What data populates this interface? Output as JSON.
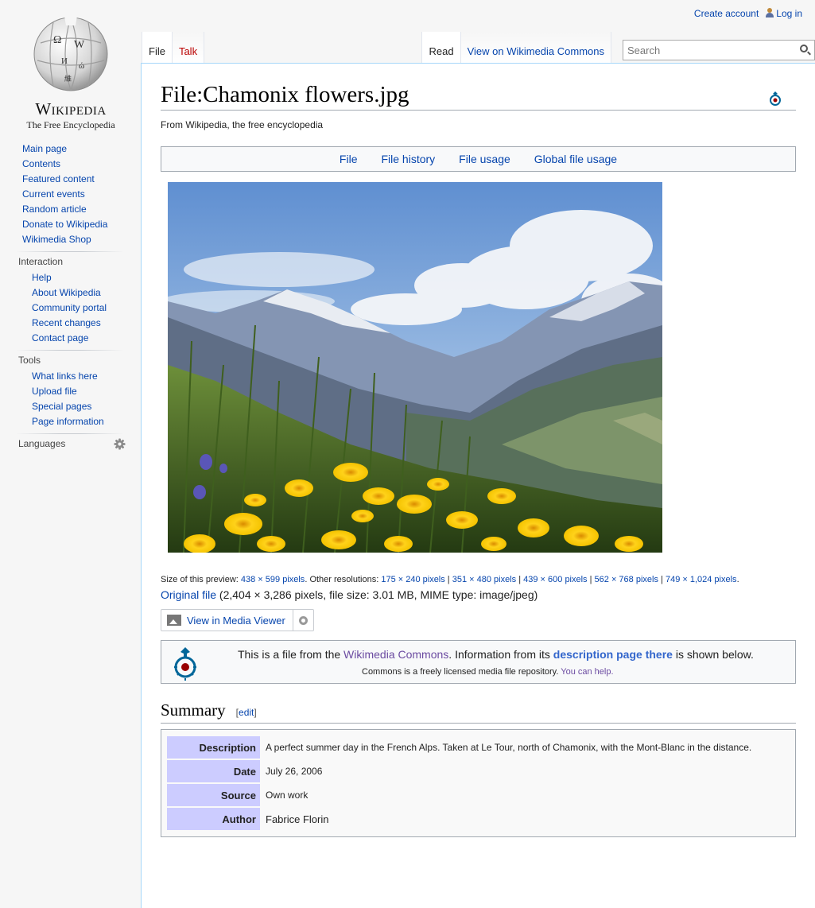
{
  "personal": {
    "create_account": "Create account",
    "log_in": "Log in"
  },
  "logo": {
    "wordmark": "Wikipedia",
    "tagline": "The Free Encyclopedia"
  },
  "sidebar": {
    "navigation": [
      "Main page",
      "Contents",
      "Featured content",
      "Current events",
      "Random article",
      "Donate to Wikipedia",
      "Wikimedia Shop"
    ],
    "interaction": {
      "heading": "Interaction",
      "items": [
        "Help",
        "About Wikipedia",
        "Community portal",
        "Recent changes",
        "Contact page"
      ]
    },
    "tools": {
      "heading": "Tools",
      "items": [
        "What links here",
        "Upload file",
        "Special pages",
        "Page information"
      ]
    },
    "languages": "Languages"
  },
  "tabs": {
    "file": "File",
    "talk": "Talk",
    "read": "Read",
    "view_commons": "View on Wikimedia Commons"
  },
  "search": {
    "placeholder": "Search"
  },
  "page": {
    "title": "File:Chamonix flowers.jpg",
    "sitesub": "From Wikipedia, the free encyclopedia"
  },
  "filetoc": [
    "File",
    "File history",
    "File usage",
    "Global file usage"
  ],
  "fileinfo": {
    "preview_label": "Size of this preview:",
    "preview_size": "438 × 599 pixels",
    "other_label": "Other resolutions:",
    "resolutions": [
      "175 × 240 pixels",
      "351 × 480 pixels",
      "439 × 600 pixels",
      "562 × 768 pixels",
      "749 × 1,024 pixels"
    ],
    "original_link": "Original file",
    "original_details": "(2,404 × 3,286 pixels, file size: 3.01 MB, MIME type: image/jpeg)"
  },
  "media_viewer": {
    "label": "View in Media Viewer"
  },
  "commons_notice": {
    "pre": "This is a file from the ",
    "commons_link": "Wikimedia Commons",
    "mid": ". Information from its ",
    "desc_link": "description page there",
    "post": " is shown below.",
    "line2_pre": "Commons is a freely licensed media file repository. ",
    "help_link": "You can help."
  },
  "summary": {
    "heading": "Summary",
    "edit": "edit",
    "rows": [
      {
        "label": "Description",
        "value": "A perfect summer day in the French Alps. Taken at Le Tour, north of Chamonix, with the Mont-Blanc in the distance."
      },
      {
        "label": "Date",
        "value": "July 26, 2006"
      },
      {
        "label": "Source",
        "value": "Own work"
      },
      {
        "label": "Author",
        "value": "Fabrice Florin"
      }
    ]
  }
}
